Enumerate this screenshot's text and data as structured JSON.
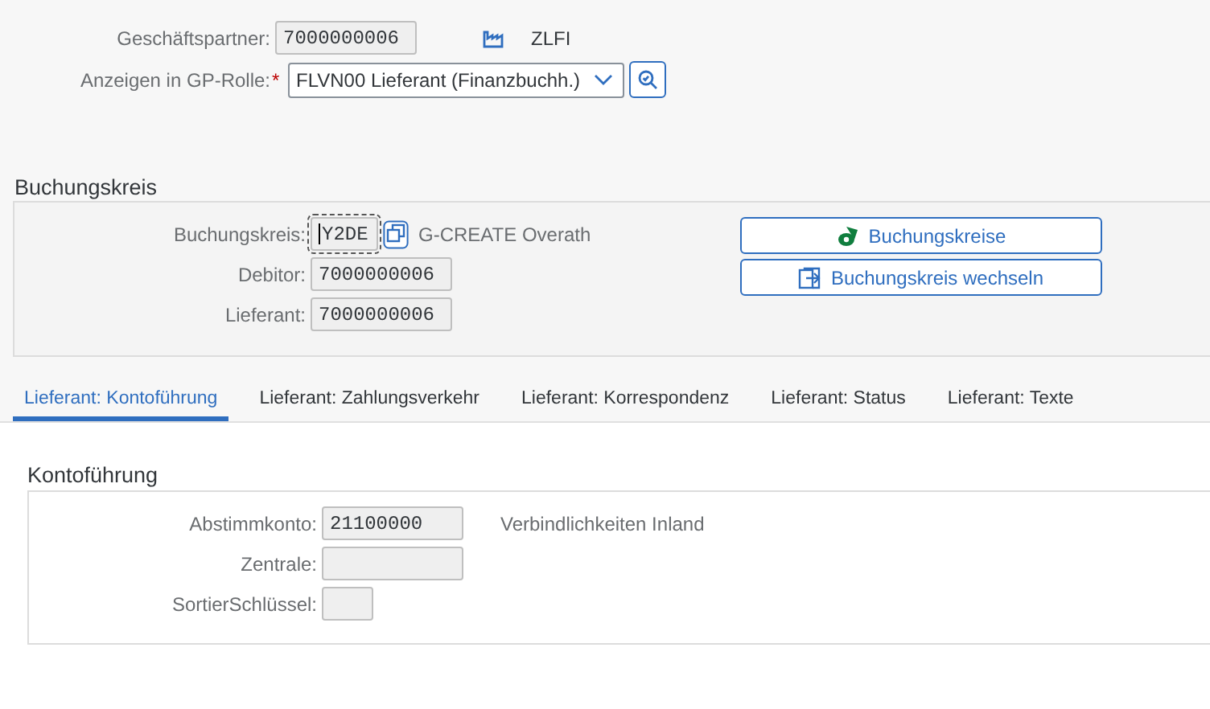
{
  "header": {
    "partner": {
      "label": "Geschäftspartner:",
      "value": "7000000006"
    },
    "partner_tag": "ZLFI",
    "role": {
      "label": "Anzeigen in GP-Rolle:",
      "required_mark": "*",
      "value": "FLVN00 Lieferant (Finanzbuchh.)"
    }
  },
  "company_section": {
    "title": "Buchungskreis",
    "fields": [
      {
        "label": "Buchungskreis:",
        "value": "Y2DE",
        "focused": true,
        "description": "G-CREATE Overath"
      },
      {
        "label": "Debitor:",
        "value": "7000000006",
        "focused": false
      },
      {
        "label": "Lieferant:",
        "value": "7000000006",
        "focused": false
      }
    ],
    "buttons": [
      {
        "label": "Buchungskreise",
        "kind": "companies"
      },
      {
        "label": "Buchungskreis wechseln",
        "kind": "switch"
      }
    ]
  },
  "tabs": [
    {
      "label": "Lieferant: Kontoführung",
      "selected": true
    },
    {
      "label": "Lieferant: Zahlungsverkehr",
      "selected": false
    },
    {
      "label": "Lieferant: Korrespondenz",
      "selected": false
    },
    {
      "label": "Lieferant: Status",
      "selected": false
    },
    {
      "label": "Lieferant: Texte",
      "selected": false
    }
  ],
  "account_section": {
    "title": "Kontoführung",
    "fields": [
      {
        "label": "Abstimmkonto:",
        "value": "21100000",
        "description": "Verbindlichkeiten Inland"
      },
      {
        "label": "Zentrale:"
      },
      {
        "label": "SortierSchlüssel:"
      }
    ]
  }
}
